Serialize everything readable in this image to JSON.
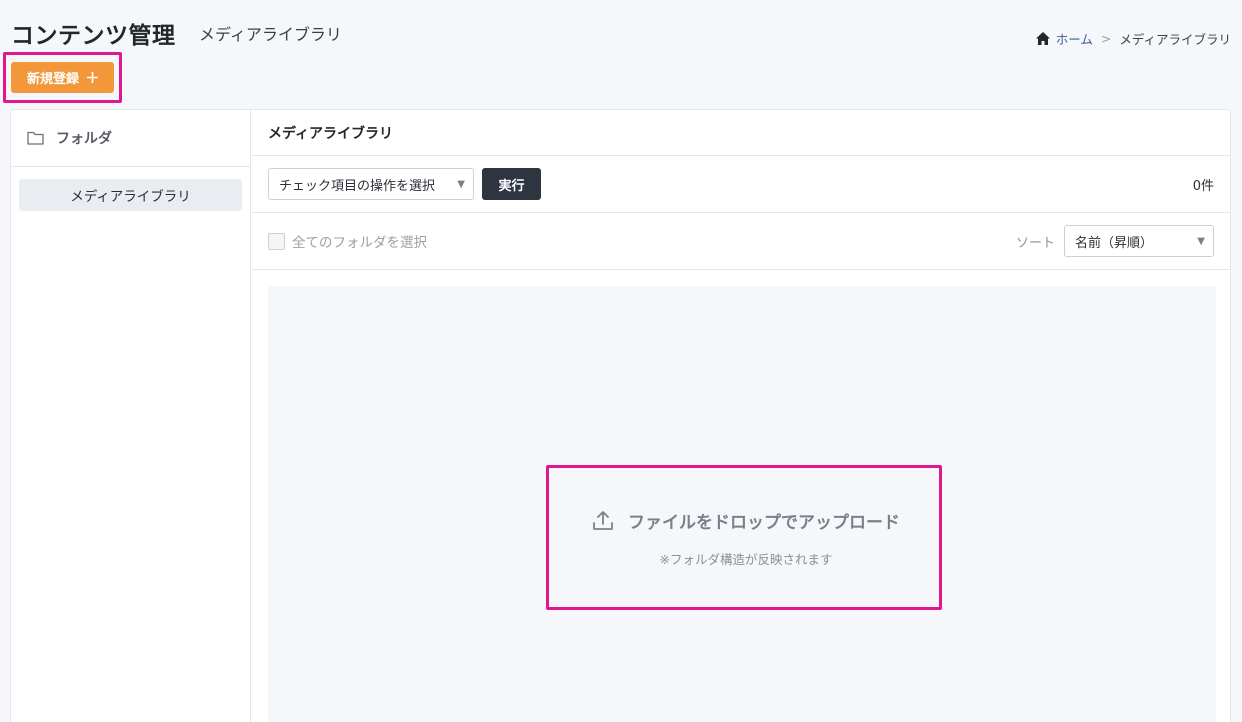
{
  "header": {
    "title": "コンテンツ管理",
    "subtitle": "メディアライブラリ",
    "new_button_label": "新規登録",
    "new_button_icon": "plus-icon"
  },
  "breadcrumb": {
    "home_icon": "home-icon",
    "home": "ホーム",
    "separator": ">",
    "current": "メディアライブラリ"
  },
  "sidebar": {
    "title": "フォルダ",
    "title_icon": "folder-icon",
    "items": [
      {
        "label": "メディアライブラリ",
        "selected": true
      }
    ]
  },
  "main": {
    "title": "メディアライブラリ",
    "bulk_action": {
      "selected": "チェック項目の操作を選択"
    },
    "execute_label": "実行",
    "count": "0件",
    "select_all_label": "全てのフォルダを選択",
    "sort_label": "ソート",
    "sort": {
      "selected": "名前（昇順）"
    },
    "dropzone": {
      "icon": "upload-icon",
      "title": "ファイルをドロップでアップロード",
      "note": "※フォルダ構造が反映されます"
    }
  },
  "colors": {
    "accent_orange": "#f2983a",
    "dark_button": "#2e3440",
    "highlight_magenta": "#e0188f"
  }
}
